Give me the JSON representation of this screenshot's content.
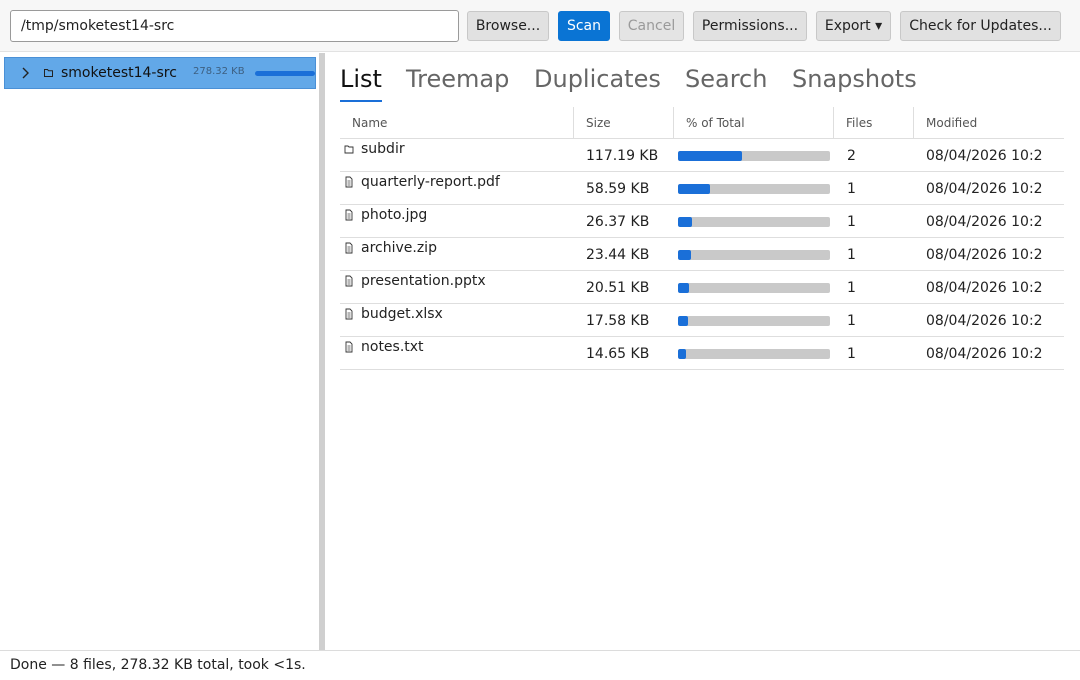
{
  "toolbar": {
    "path_value": "/tmp/smoketest14-src",
    "browse_label": "Browse...",
    "scan_label": "Scan",
    "cancel_label": "Cancel",
    "permissions_label": "Permissions...",
    "export_label": "Export ▾",
    "updates_label": "Check for Updates..."
  },
  "tree": {
    "root": {
      "label": "smoketest14-src",
      "size": "278.32 KB",
      "icon": "folder-icon",
      "expand_icon": "chevron-right-icon"
    }
  },
  "tabs": [
    {
      "label": "List",
      "active": true
    },
    {
      "label": "Treemap",
      "active": false
    },
    {
      "label": "Duplicates",
      "active": false
    },
    {
      "label": "Search",
      "active": false
    },
    {
      "label": "Snapshots",
      "active": false
    }
  ],
  "table": {
    "columns": [
      "Name",
      "Size",
      "% of Total",
      "Files",
      "Modified"
    ],
    "rows": [
      {
        "name": "subdir",
        "type": "folder",
        "size": "117.19 KB",
        "percent": 42.1,
        "files": "2",
        "modified": "08/04/2026 10:2"
      },
      {
        "name": "quarterly-report.pdf",
        "type": "file",
        "size": "58.59 KB",
        "percent": 21.1,
        "files": "1",
        "modified": "08/04/2026 10:2"
      },
      {
        "name": "photo.jpg",
        "type": "file",
        "size": "26.37 KB",
        "percent": 9.5,
        "files": "1",
        "modified": "08/04/2026 10:2"
      },
      {
        "name": "archive.zip",
        "type": "file",
        "size": "23.44 KB",
        "percent": 8.4,
        "files": "1",
        "modified": "08/04/2026 10:2"
      },
      {
        "name": "presentation.pptx",
        "type": "file",
        "size": "20.51 KB",
        "percent": 7.4,
        "files": "1",
        "modified": "08/04/2026 10:2"
      },
      {
        "name": "budget.xlsx",
        "type": "file",
        "size": "17.58 KB",
        "percent": 6.3,
        "files": "1",
        "modified": "08/04/2026 10:2"
      },
      {
        "name": "notes.txt",
        "type": "file",
        "size": "14.65 KB",
        "percent": 5.3,
        "files": "1",
        "modified": "08/04/2026 10:2"
      }
    ]
  },
  "status": {
    "text": "Done — 8 files, 278.32 KB total, took <1s."
  },
  "colors": {
    "accent": "#1a6fd8",
    "primary_button": "#0a74d4",
    "tree_selection": "#62a8e8",
    "bar_track": "#c9c9c9"
  }
}
